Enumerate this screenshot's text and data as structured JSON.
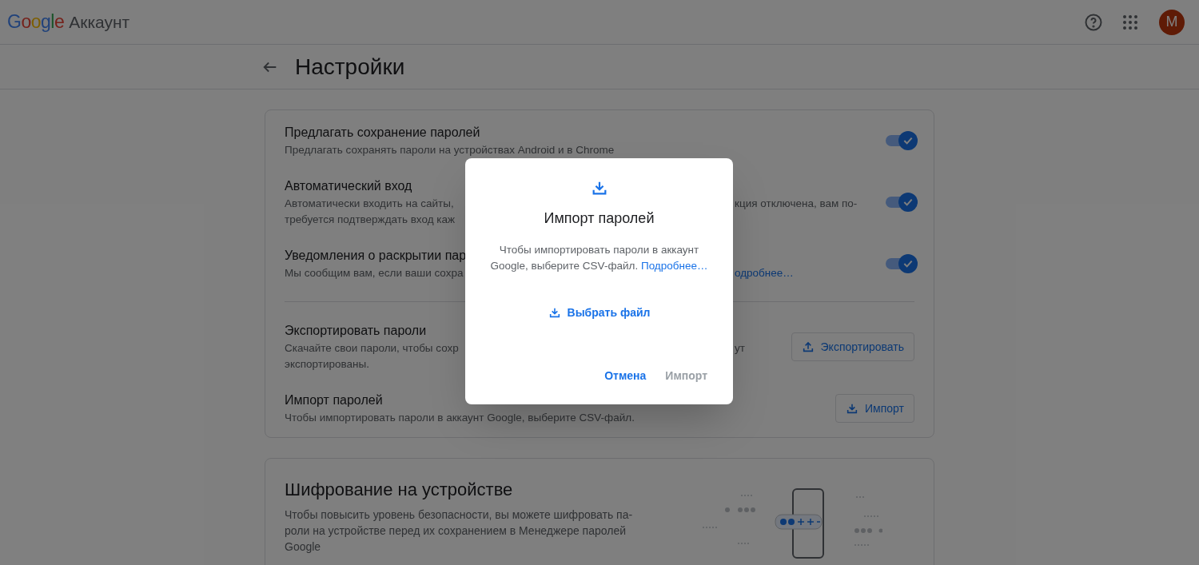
{
  "header": {
    "logo": "Google",
    "product": "Аккаунт",
    "avatar_letter": "M"
  },
  "page_title": "Настройки",
  "settings": [
    {
      "kind": "toggle",
      "title": "Предлагать сохранение паролей",
      "on": true,
      "desc_lines": [
        {
          "left": "Предлагать сохранять пароли на устройствах Android и в Chrome"
        }
      ]
    },
    {
      "kind": "toggle",
      "title": "Автоматический вход",
      "on": true,
      "desc_lines": [
        {
          "left": "Автоматически входить на сайты,",
          "right": "кция отключена, вам по-"
        },
        {
          "left": "требуется подтверждать вход каж"
        }
      ]
    },
    {
      "kind": "toggle",
      "title": "Уведомления о раскрытии пар",
      "on": true,
      "desc_lines": [
        {
          "left": "Мы сообщим вам, если ваши сохра",
          "right_link": "одробнее…"
        }
      ]
    },
    {
      "kind": "export",
      "title": "Экспортировать пароли",
      "button": "Экспортировать",
      "divider_before": true,
      "desc_lines": [
        {
          "left": "Скачайте свои пароли, чтобы сохр",
          "right": "ут"
        },
        {
          "left": "экспортированы."
        }
      ]
    },
    {
      "kind": "import",
      "title": "Импорт паролей",
      "button": "Импорт",
      "desc_lines": [
        {
          "left": "Чтобы импортировать пароли в аккаунт Google, выберите CSV-файл."
        }
      ]
    }
  ],
  "encryption": {
    "title": "Шифрование на устройстве",
    "text": "Чтобы повысить уровень безопасности, вы можете шифровать па-роли на устройстве перед их сохранением в Менеджере паролей Google"
  },
  "dialog": {
    "title": "Импорт паролей",
    "text": "Чтобы импортировать пароли в аккаунт Google, выберите CSV-файл.",
    "link": "Подробнее…",
    "choose_button": "Выбрать файл",
    "actions": [
      {
        "label": "Отмена",
        "disabled": false
      },
      {
        "label": "Импорт",
        "disabled": true
      }
    ]
  }
}
